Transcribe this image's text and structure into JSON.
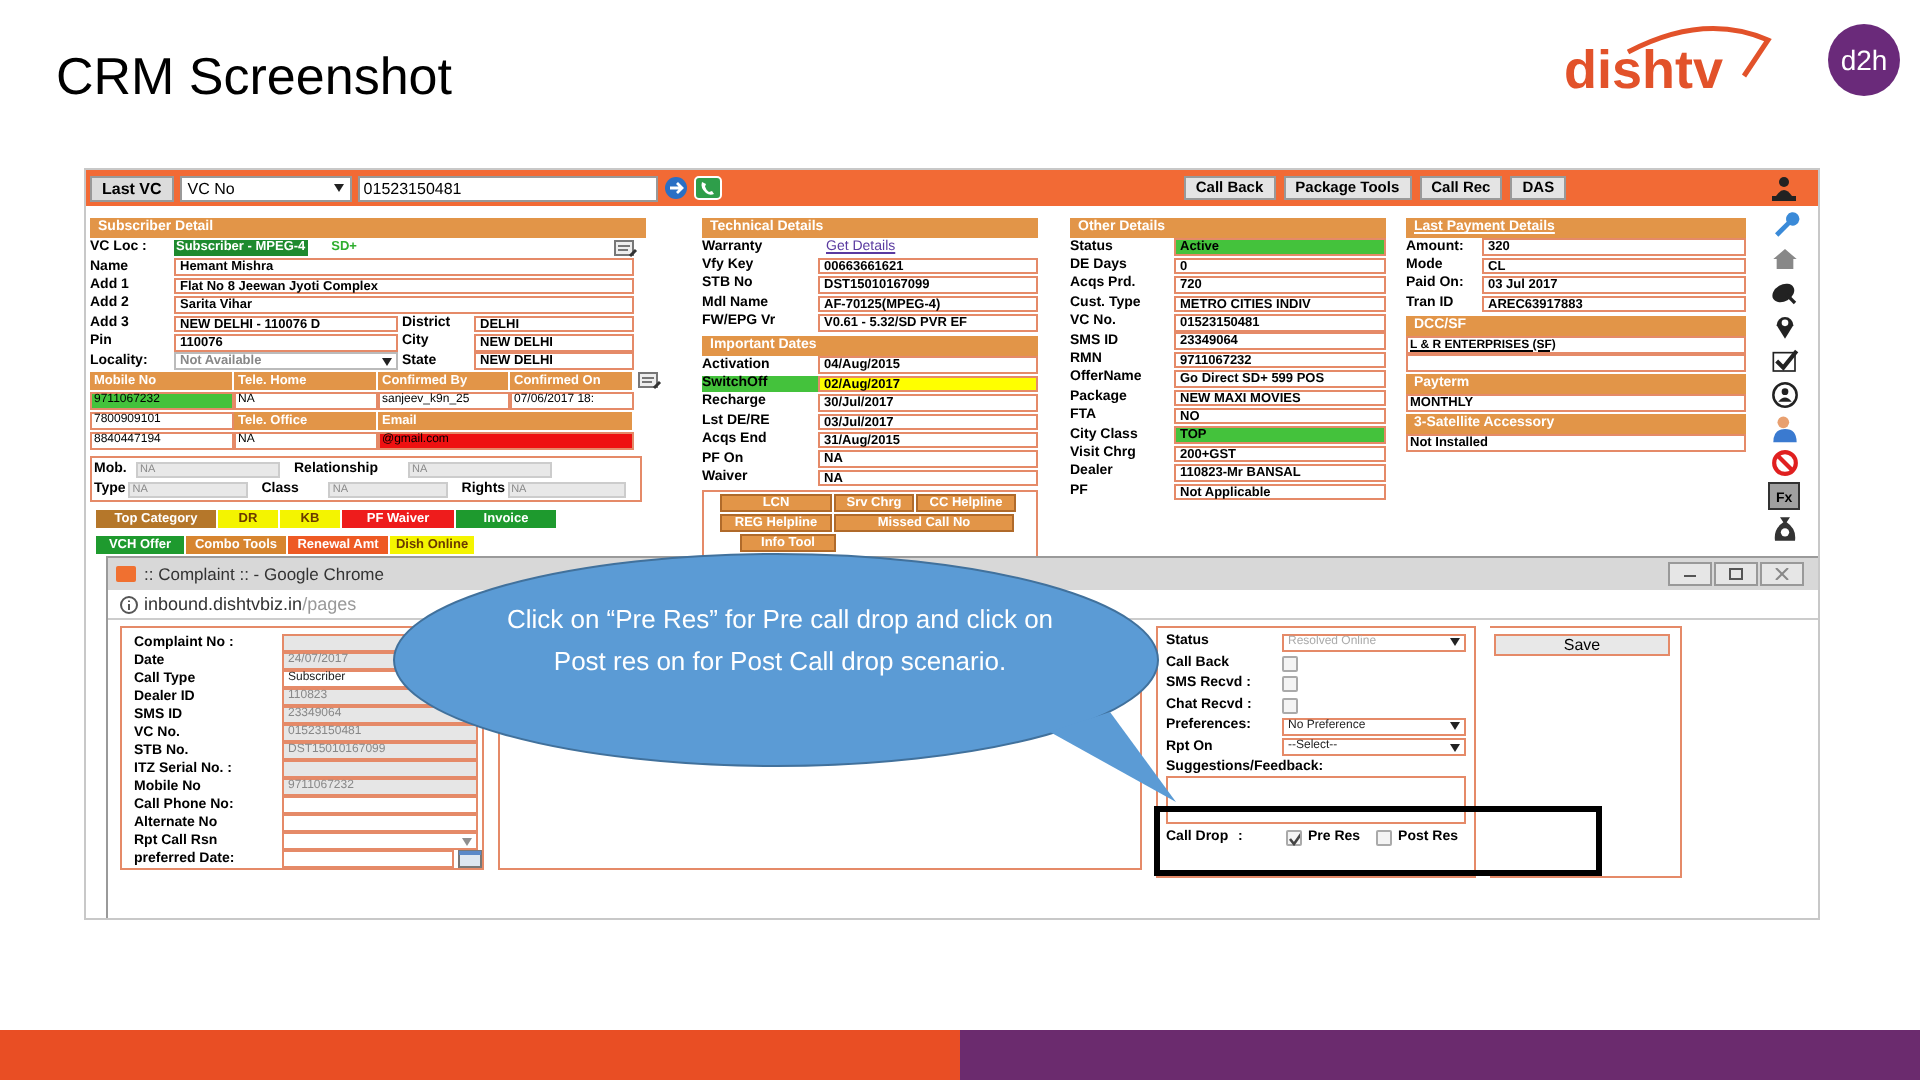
{
  "slide": {
    "title": "CRM Screenshot",
    "logo_text": "dishtv",
    "badge_text": "d2h"
  },
  "toolbar": {
    "last_vc": "Last VC",
    "search_type": "VC No",
    "search_value": "01523150481",
    "buttons": [
      "Call Back",
      "Package Tools",
      "Call Rec",
      "DAS"
    ]
  },
  "subscriber": {
    "title": "Subscriber Detail",
    "vc_loc": {
      "label": "VC Loc :",
      "value": "Subscriber - MPEG-4",
      "tag": "SD+"
    },
    "rows": [
      {
        "kind": "wide",
        "label": "Name",
        "value": "Hemant Mishra"
      },
      {
        "kind": "wide",
        "label": "Add 1",
        "value": "Flat No 8 Jeewan Jyoti Complex"
      },
      {
        "kind": "wide",
        "label": "Add 2",
        "value": "Sarita Vihar"
      },
      {
        "kind": "pair",
        "label": "Add 3",
        "value": "NEW DELHI - 110076 D",
        "side_label": "District",
        "side_value": "DELHI"
      },
      {
        "kind": "pair",
        "label": "Pin",
        "value": "110076",
        "side_label": "City",
        "side_value": "NEW DELHI"
      },
      {
        "kind": "select_pair",
        "label": "Locality:",
        "value": "Not Available",
        "side_label": "State",
        "side_value": "NEW DELHI"
      }
    ],
    "contacts": [
      [
        {
          "kind": "header",
          "text": "Mobile No"
        },
        {
          "kind": "header",
          "text": "Tele. Home"
        },
        {
          "kind": "header",
          "text": "Confirmed By"
        },
        {
          "kind": "header",
          "text": "Confirmed On"
        }
      ],
      [
        {
          "kind": "value",
          "text": "9711067232",
          "color": "#44c23c"
        },
        {
          "kind": "value",
          "text": "NA"
        },
        {
          "kind": "value",
          "text": "sanjeev_k9n_25"
        },
        {
          "kind": "value",
          "text": "07/06/2017 18:"
        }
      ],
      [
        {
          "kind": "value",
          "text": "7800909101"
        },
        {
          "kind": "header",
          "text": "Tele. Office"
        },
        {
          "kind": "header",
          "text": "Email"
        }
      ],
      [
        {
          "kind": "value",
          "text": "8840447194"
        },
        {
          "kind": "value",
          "text": "NA"
        },
        {
          "kind": "value",
          "text": "@gmail.com",
          "color": "#ee1111"
        }
      ]
    ],
    "misc": [
      [
        {
          "label": "Mob.",
          "value": "NA"
        },
        {
          "label": "Relationship",
          "value": "NA"
        }
      ],
      [
        {
          "label": "Type",
          "value": "NA"
        },
        {
          "label": "Class",
          "value": "NA"
        },
        {
          "label": "Rights",
          "value": "NA"
        }
      ]
    ],
    "categories": [
      [
        {
          "text": "Top Category",
          "color": "#b5772a"
        },
        {
          "text": "DR",
          "color": "#f4f400"
        },
        {
          "text": "KB",
          "color": "#f4f400"
        },
        {
          "text": "PF Waiver",
          "color": "#ee1c1c"
        },
        {
          "text": "Invoice",
          "color": "#1e9a2e"
        }
      ],
      [
        {
          "text": "VCH Offer",
          "color": "#1e9a2e"
        },
        {
          "text": "Combo Tools",
          "color": "#d7852f"
        },
        {
          "text": "Renewal Amt",
          "color": "#ee5a24"
        },
        {
          "text": "Dish Online",
          "color": "#f4f400"
        }
      ]
    ]
  },
  "technical": {
    "title": "Technical Details",
    "rows": [
      {
        "kind": "link",
        "label": "Warranty",
        "value": "Get Details"
      },
      {
        "kind": "text",
        "label": "Vfy Key",
        "value": "00663661621"
      },
      {
        "kind": "text",
        "label": "STB No",
        "value": "DST15010167099"
      },
      {
        "kind": "text",
        "label": "Mdl Name",
        "value": "AF-70125(MPEG-4)"
      },
      {
        "kind": "text",
        "label": "FW/EPG Vr",
        "value": "V0.61 - 5.32/SD PVR EF"
      }
    ]
  },
  "important_dates": {
    "title": "Important Dates",
    "rows": [
      {
        "label": "Activation",
        "value": "04/Aug/2015",
        "label_highlighted": false
      },
      {
        "label": "SwitchOff",
        "value": "02/Aug/2017",
        "label_highlighted": true,
        "color": "#ffff00"
      },
      {
        "label": "Recharge",
        "value": "30/Jul/2017",
        "label_highlighted": false
      },
      {
        "label": "Lst DE/RE",
        "value": "03/Jul/2017",
        "label_highlighted": false
      },
      {
        "label": "Acqs End",
        "value": "31/Aug/2015",
        "label_highlighted": false
      },
      {
        "label": "PF On",
        "value": "NA",
        "label_highlighted": false
      },
      {
        "label": "Waiver",
        "value": "NA",
        "label_highlighted": false
      }
    ]
  },
  "tools": [
    [
      "LCN",
      "Srv Chrg",
      "CC Helpline"
    ],
    [
      "REG Helpline",
      "Missed Call No"
    ],
    [
      "Info Tool"
    ]
  ],
  "other": {
    "title": "Other Details",
    "rows": [
      {
        "label": "Status",
        "value": "Active",
        "color": "#44c23c"
      },
      {
        "label": "DE Days",
        "value": "0"
      },
      {
        "label": "Acqs Prd.",
        "value": "720"
      },
      {
        "label": "Cust. Type",
        "value": "METRO CITIES INDIV"
      },
      {
        "label": "VC No.",
        "value": "01523150481"
      },
      {
        "label": "SMS ID",
        "value": "23349064"
      },
      {
        "label": "RMN",
        "value": "9711067232"
      },
      {
        "label": "OfferName",
        "value": "Go Direct SD+ 599 POS"
      },
      {
        "label": "Package",
        "value": "NEW MAXI MOVIES"
      },
      {
        "label": "FTA",
        "value": "NO"
      },
      {
        "label": "City Class",
        "value": "TOP",
        "color": "#44c23c"
      },
      {
        "label": "Visit Chrg",
        "value": "200+GST"
      },
      {
        "label": "Dealer",
        "value": "110823-Mr BANSAL"
      },
      {
        "label": "PF",
        "value": "Not Applicable"
      }
    ]
  },
  "payment": {
    "title": "Last Payment Details",
    "rows": [
      {
        "label": "Amount:",
        "value": "320"
      },
      {
        "label": "Mode",
        "value": "CL"
      },
      {
        "label": "Paid On:",
        "value": "03 Jul 2017"
      },
      {
        "label": "Tran ID",
        "value": "AREC63917883"
      }
    ],
    "sections": [
      {
        "title": "DCC/SF",
        "value": "L & R ENTERPRISES (SF)",
        "kind": "link"
      },
      {
        "title": "Payterm",
        "value": "MONTHLY",
        "kind": "text"
      },
      {
        "title": "3-Satellite Accessory",
        "value": "Not Installed",
        "kind": "text"
      }
    ]
  },
  "side_toolbar": {
    "fx_label": "Fx"
  },
  "popup": {
    "title": ":: Complaint :: - Google Chrome",
    "url": "inbound.dishtvbiz.in",
    "url_path": "/pages",
    "fields": [
      {
        "kind": "text",
        "label": "Complaint No :",
        "disabled": true
      },
      {
        "kind": "text",
        "label": "Date",
        "value": "24/07/2017",
        "disabled": true
      },
      {
        "kind": "select",
        "label": "Call Type",
        "value": "Subscriber",
        "disabled": false
      },
      {
        "kind": "text",
        "label": "Dealer ID",
        "value": "110823",
        "disabled": true
      },
      {
        "kind": "text",
        "label": "SMS ID",
        "value": "23349064",
        "disabled": true
      },
      {
        "kind": "text",
        "label": "VC No.",
        "value": "01523150481",
        "disabled": true
      },
      {
        "kind": "text",
        "label": "STB No.",
        "value": "DST15010167099",
        "disabled": true
      },
      {
        "kind": "text",
        "label": "ITZ Serial No. :",
        "disabled": true
      },
      {
        "kind": "text",
        "label": "Mobile No",
        "value": "9711067232",
        "disabled": true
      },
      {
        "kind": "text",
        "label": "Call Phone No:",
        "disabled": false
      },
      {
        "kind": "text",
        "label": "Alternate No",
        "disabled": false
      },
      {
        "kind": "select",
        "label": "Rpt Call Rsn",
        "disabled": false
      },
      {
        "kind": "date",
        "label": "preferred Date:",
        "disabled": false
      }
    ],
    "status_rows": [
      {
        "kind": "select",
        "label": "Status",
        "value": "Resolved Online",
        "disabled": true
      },
      {
        "kind": "checkbox",
        "label": "Call Back",
        "checked": false
      },
      {
        "kind": "checkbox",
        "label": "SMS Recvd :",
        "checked": false
      },
      {
        "kind": "checkbox",
        "label": "Chat Recvd :",
        "checked": false
      },
      {
        "kind": "select",
        "label": "Preferences:",
        "value": "No Preference",
        "disabled": false
      },
      {
        "kind": "select",
        "label": "Rpt On",
        "value": "--Select--",
        "disabled": false
      }
    ],
    "feedback_label": "Suggestions/Feedback:",
    "call_drop": {
      "label": "Call Drop",
      "separator": ":",
      "options": [
        {
          "label": "Pre Res",
          "checked": true
        },
        {
          "label": "Post Res",
          "checked": false
        }
      ]
    },
    "save": "Save"
  },
  "callout": {
    "text": "Click on “Pre Res” for Pre call drop and click on Post res on for Post Call drop scenario."
  }
}
